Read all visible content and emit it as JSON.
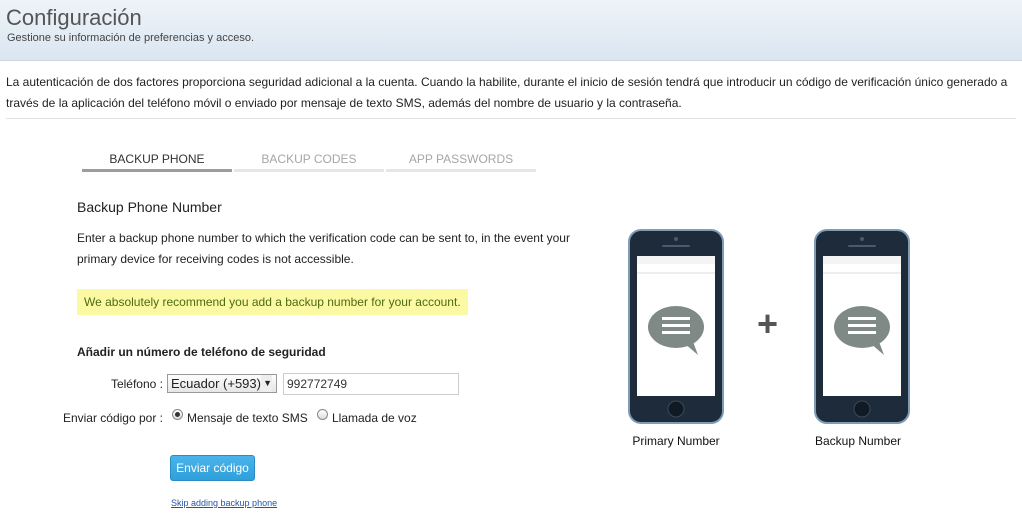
{
  "header": {
    "title": "Configuración",
    "subtitle": "Gestione su información de preferencias y acceso."
  },
  "intro": "La autenticación de dos factores proporciona seguridad adicional a la cuenta. Cuando la habilite, durante el inicio de sesión tendrá que introducir un código de verificación único generado a través de la aplicación del teléfono móvil o enviado por mensaje de texto SMS, además del nombre de usuario y la contraseña.",
  "tabs": [
    {
      "label": "BACKUP PHONE",
      "active": true
    },
    {
      "label": "BACKUP CODES",
      "active": false
    },
    {
      "label": "APP PASSWORDS",
      "active": false
    }
  ],
  "section": {
    "title": "Backup Phone Number",
    "description": "Enter a backup phone number to which the verification code can be sent to, in the event your primary device for receiving codes is not accessible.",
    "notice": "We absolutely recommend you add a backup number for your account."
  },
  "form": {
    "heading": "Añadir un número de teléfono de seguridad",
    "phone_label": "Teléfono :",
    "country_value": "Ecuador (+593)",
    "phone_value": "992772749",
    "send_via_label": "Enviar código por :",
    "options": [
      {
        "label": "Mensaje de texto SMS",
        "checked": true
      },
      {
        "label": "Llamada de voz",
        "checked": false
      }
    ],
    "submit_label": "Enviar código",
    "skip_label": "Skip adding backup phone"
  },
  "illustration": {
    "primary_caption": "Primary Number",
    "plus": "+",
    "backup_caption": "Backup Number"
  },
  "colors": {
    "notice_bg": "#fbf9a1",
    "notice_text": "#4e6a16",
    "button": "#36a6df",
    "phone_body": "#1d2b3a",
    "bubble": "#7f8a86"
  },
  "icons": [
    "caret-down-icon",
    "radio-checked-icon",
    "radio-unchecked-icon",
    "chat-bubble-icon"
  ]
}
